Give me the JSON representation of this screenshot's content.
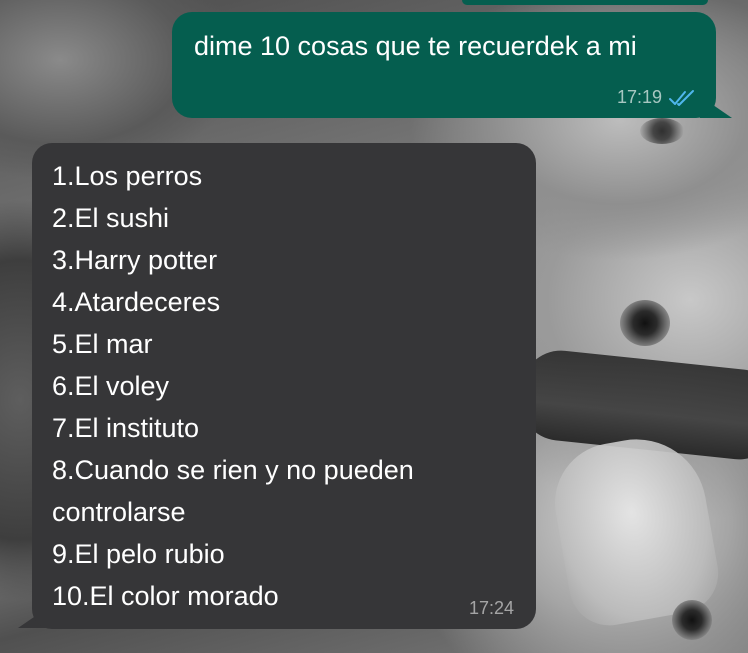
{
  "conversation": {
    "outgoing": {
      "text": "dime 10 cosas que te recuerdek a mi",
      "time": "17:19",
      "status_icon": "double-check-read-icon",
      "bubble_color": "#055e4f",
      "tick_color": "#4fb6ec"
    },
    "incoming": {
      "items": [
        "1.Los perros",
        "2.El sushi",
        "3.Harry potter",
        "4.Atardeceres",
        "5.El mar",
        "6.El voley",
        "7.El instituto",
        "8.Cuando se rien y no pueden controlarse",
        "9.El pelo rubio",
        "10.El color morado"
      ],
      "time": "17:24",
      "bubble_color": "#363638"
    }
  }
}
